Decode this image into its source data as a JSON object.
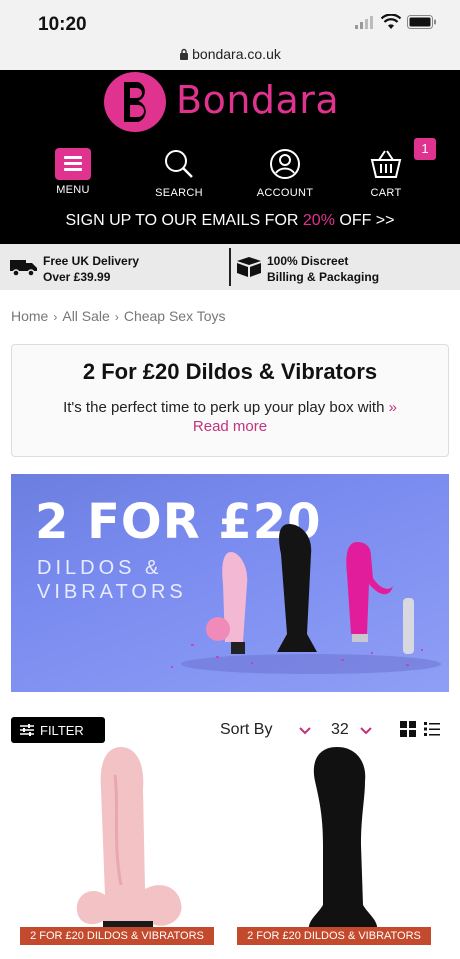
{
  "status": {
    "time": "10:20"
  },
  "url": "bondara.co.uk",
  "brand": {
    "name": "Bondara",
    "color": "#e0338f"
  },
  "nav": {
    "menu": "MENU",
    "search": "SEARCH",
    "account": "ACCOUNT",
    "cart": "CART",
    "cart_count": "1"
  },
  "signup": {
    "pre": "SIGN UP TO OUR EMAILS FOR ",
    "percent": "20%",
    "post": " OFF >>"
  },
  "usp": {
    "delivery_line1": "Free UK Delivery",
    "delivery_line2": "Over £39.99",
    "discreet_line1": "100% Discreet",
    "discreet_line2": "Billing & Packaging"
  },
  "breadcrumb": [
    "Home",
    "All Sale",
    "Cheap Sex Toys"
  ],
  "promo": {
    "title": "2 For £20 Dildos & Vibrators",
    "text": "It's the perfect time to perk up your play box with",
    "chevron": "»",
    "read_more": "Read more"
  },
  "banner": {
    "headline": "2 FOR £20",
    "line1": "DILDOS &",
    "line2": "VIBRATORS"
  },
  "toolbar": {
    "filter": "FILTER",
    "sort_label": "Sort By",
    "per_page": "32"
  },
  "products": [
    {
      "tag": "2 FOR £20 DILDOS & VIBRATORS"
    },
    {
      "tag": "2 FOR £20 DILDOS & VIBRATORS"
    }
  ]
}
